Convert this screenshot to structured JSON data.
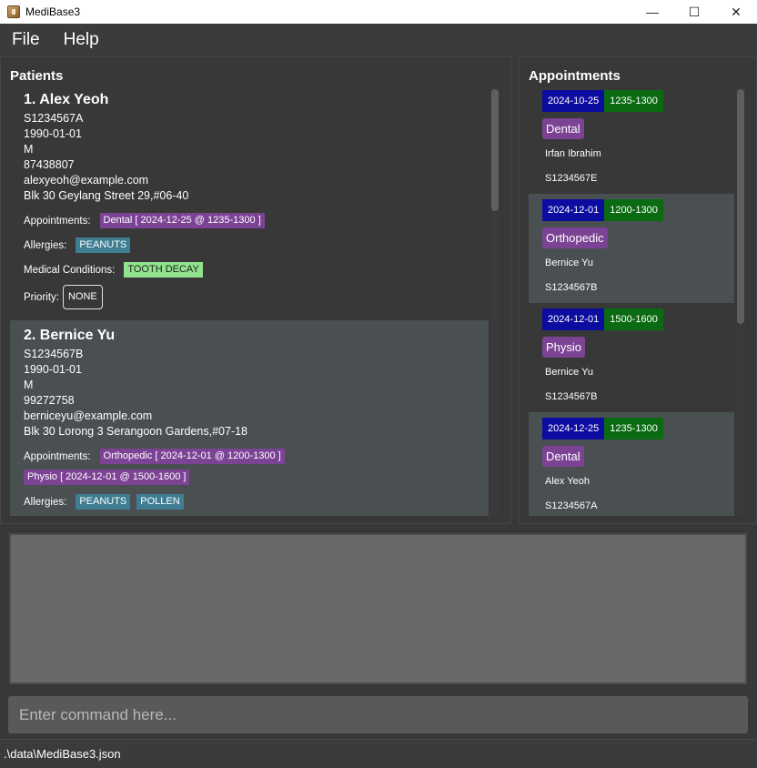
{
  "window": {
    "title": "MediBase3",
    "controls": {
      "minimize": "—",
      "maximize": "☐",
      "close": "✕"
    }
  },
  "menu": {
    "file": "File",
    "help": "Help"
  },
  "patients_panel": {
    "title": "Patients",
    "patients": [
      {
        "name": "1. Alex Yeoh",
        "nric": "S1234567A",
        "dob": "1990-01-01",
        "gender": "M",
        "phone": "87438807",
        "email": "alexyeoh@example.com",
        "address": "Blk 30 Geylang Street 29,#06-40",
        "appointments_label": "Appointments:",
        "appointments": [
          "Dental [ 2024-12-25 @ 1235-1300 ]"
        ],
        "allergies_label": "Allergies:",
        "allergies": [
          "PEANUTS"
        ],
        "conditions_label": "Medical Conditions:",
        "conditions": [
          "TOOTH DECAY"
        ],
        "priority_label": "Priority:",
        "priority": "NONE"
      },
      {
        "name": "2. Bernice Yu",
        "nric": "S1234567B",
        "dob": "1990-01-01",
        "gender": "M",
        "phone": "99272758",
        "email": "berniceyu@example.com",
        "address": "Blk 30 Lorong 3 Serangoon Gardens,#07-18",
        "appointments_label": "Appointments:",
        "appointments": [
          "Orthopedic [ 2024-12-01 @ 1200-1300 ]",
          "Physio [ 2024-12-01 @ 1500-1600 ]"
        ],
        "allergies_label": "Allergies:",
        "allergies": [
          "PEANUTS",
          "POLLEN"
        ]
      }
    ]
  },
  "appointments_panel": {
    "title": "Appointments",
    "appointments": [
      {
        "date": "2024-10-25",
        "time": "1235-1300",
        "type": "Dental",
        "name": "Irfan Ibrahim",
        "nric": "S1234567E"
      },
      {
        "date": "2024-12-01",
        "time": "1200-1300",
        "type": "Orthopedic",
        "name": "Bernice Yu",
        "nric": "S1234567B"
      },
      {
        "date": "2024-12-01",
        "time": "1500-1600",
        "type": "Physio",
        "name": "Bernice Yu",
        "nric": "S1234567B"
      },
      {
        "date": "2024-12-25",
        "time": "1235-1300",
        "type": "Dental",
        "name": "Alex Yeoh",
        "nric": "S1234567A"
      }
    ]
  },
  "command": {
    "placeholder": "Enter command here..."
  },
  "status": {
    "path": ".\\data\\MediBase3.json"
  }
}
